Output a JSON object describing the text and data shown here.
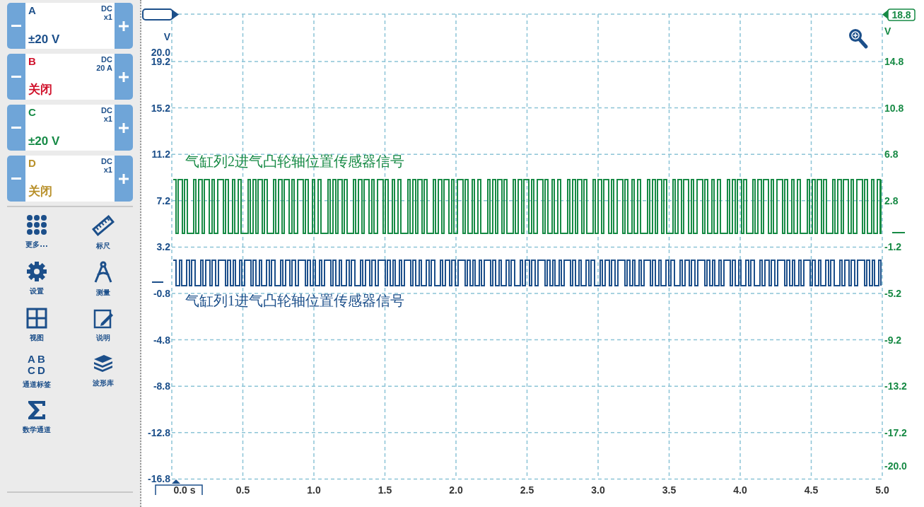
{
  "channels": [
    {
      "name": "A",
      "coupling": "DC",
      "probe": "x1",
      "reading": "±20 V",
      "color": "#1c4f8a"
    },
    {
      "name": "B",
      "coupling": "DC",
      "probe": "20 A",
      "reading": "关闭",
      "color": "#d0102a"
    },
    {
      "name": "C",
      "coupling": "DC",
      "probe": "x1",
      "reading": "±20 V",
      "color": "#168a46"
    },
    {
      "name": "D",
      "coupling": "DC",
      "probe": "x1",
      "reading": "关闭",
      "color": "#b8902a"
    }
  ],
  "tools": [
    {
      "kind": "more",
      "label": "更多..."
    },
    {
      "kind": "ruler",
      "label": "标尺"
    },
    {
      "kind": "settings",
      "label": "设置"
    },
    {
      "kind": "measure",
      "label": "测量"
    },
    {
      "kind": "view",
      "label": "视图"
    },
    {
      "kind": "notes",
      "label": "说明"
    },
    {
      "kind": "labels",
      "label": "通道标签",
      "icon_letters": [
        "A",
        "B",
        "C",
        "D"
      ]
    },
    {
      "kind": "library",
      "label": "波形库"
    },
    {
      "kind": "math",
      "label": "数学通道"
    }
  ],
  "plot": {
    "left_unit": "V",
    "left_ticks": [
      "20.0",
      "19.2",
      "15.2",
      "11.2",
      "7.2",
      "3.2",
      "-0.8",
      "-4.8",
      "-8.8",
      "-12.8",
      "-16.8"
    ],
    "right_marker": "18.8",
    "right_unit": "V",
    "right_ticks": [
      "14.8",
      "10.8",
      "6.8",
      "2.8",
      "-1.2",
      "-5.2",
      "-9.2",
      "-13.2",
      "-17.2",
      "-20.0"
    ],
    "x_ticks": [
      "0.0 s",
      "0.5",
      "1.0",
      "1.5",
      "2.0",
      "2.5",
      "3.0",
      "3.5",
      "4.0",
      "4.5",
      "5.0"
    ],
    "signals": [
      {
        "label": "气缸列2进气凸轮轴位置传感器信号",
        "color": "#178a45"
      },
      {
        "label": "气缸列1进气凸轮轴位置传感器信号",
        "color": "#1c4f8a"
      }
    ]
  }
}
